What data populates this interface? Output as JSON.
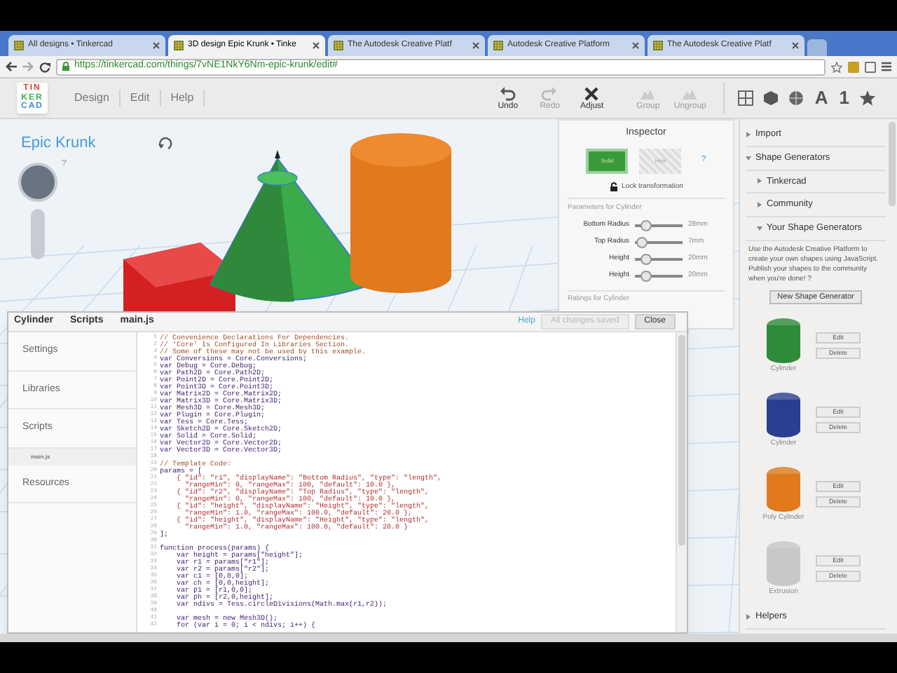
{
  "browser": {
    "tabs": [
      {
        "label": "All designs • Tinkercad",
        "selected": false
      },
      {
        "label": "3D design Epic Krunk • Tinke",
        "selected": true
      },
      {
        "label": "The Autodesk Creative Platf",
        "selected": false
      },
      {
        "label": "Autodesk Creative Platform",
        "selected": false
      },
      {
        "label": "The Autodesk Creative Platf",
        "selected": false
      }
    ],
    "url": "https://tinkercad.com/things/7vNE1NkY6Nm-epic-krunk/edit#"
  },
  "app_toolbar": {
    "logo": [
      "TIN",
      "KER",
      "CAD"
    ],
    "menu": [
      "Design",
      "Edit",
      "Help"
    ],
    "tools": [
      {
        "label": "Undo",
        "kind": "undo",
        "disabled": false
      },
      {
        "label": "Redo",
        "kind": "redo",
        "disabled": true
      },
      {
        "label": "Adjust",
        "kind": "adjust",
        "disabled": false
      },
      {
        "label": "Group",
        "kind": "group",
        "disabled": true
      },
      {
        "label": "Ungroup",
        "kind": "ungroup",
        "disabled": true
      }
    ],
    "view_glyphs": [
      "A",
      "1"
    ]
  },
  "design_title": "Epic Krunk",
  "view_help": "?",
  "inspector": {
    "title": "Inspector",
    "modes": [
      {
        "label": "Solid",
        "kind": "solid",
        "selected": true
      },
      {
        "label": "Hole",
        "kind": "hole",
        "selected": false
      }
    ],
    "help": "?",
    "lock_label": "Lock transformation",
    "params_heading": "Parameters for Cylinder",
    "params": [
      {
        "name": "Bottom Radius",
        "level": 0.15,
        "reading": "28mm"
      },
      {
        "name": "Top Radius",
        "level": 0.05,
        "reading": "7mm"
      },
      {
        "name": "Height",
        "level": 0.15,
        "reading": "20mm"
      },
      {
        "name": "Height",
        "level": 0.15,
        "reading": "20mm"
      }
    ],
    "ratings_heading": "Ratings for Cylinder"
  },
  "editor": {
    "breadcrumb": [
      "Cylinder",
      "Scripts",
      "main.js"
    ],
    "help_link": "Help",
    "save_status": "All changes saved",
    "close": "Close",
    "sidebar": [
      {
        "label": "Settings",
        "kind": "section",
        "selected": false
      },
      {
        "label": "Libraries",
        "kind": "section",
        "selected": false
      },
      {
        "label": "Scripts",
        "kind": "section",
        "selected": false
      },
      {
        "label": "main.js",
        "kind": "file",
        "selected": true
      },
      {
        "label": "Resources",
        "kind": "section",
        "selected": false
      }
    ],
    "code": [
      {
        "n": "1",
        "kind": "comment",
        "text": "// Convenience Declarations For Dependencies."
      },
      {
        "n": "2",
        "kind": "comment",
        "text": "// 'Core' Is Configured In Libraries Section."
      },
      {
        "n": "3",
        "kind": "comment",
        "text": "// Some of these may not be used by this example."
      },
      {
        "n": "4",
        "kind": "code",
        "text": "var Conversions = Core.Conversions;"
      },
      {
        "n": "5",
        "kind": "code",
        "text": "var Debug = Core.Debug;"
      },
      {
        "n": "6",
        "kind": "code",
        "text": "var Path2D = Core.Path2D;"
      },
      {
        "n": "7",
        "kind": "code",
        "text": "var Point2D = Core.Point2D;"
      },
      {
        "n": "8",
        "kind": "code",
        "text": "var Point3D = Core.Point3D;"
      },
      {
        "n": "9",
        "kind": "code",
        "text": "var Matrix2D = Core.Matrix2D;"
      },
      {
        "n": "10",
        "kind": "code",
        "text": "var Matrix3D = Core.Matrix3D;"
      },
      {
        "n": "11",
        "kind": "code",
        "text": "var Mesh3D = Core.Mesh3D;"
      },
      {
        "n": "12",
        "kind": "code",
        "text": "var Plugin = Core.Plugin;"
      },
      {
        "n": "13",
        "kind": "code",
        "text": "var Tess = Core.Tess;"
      },
      {
        "n": "14",
        "kind": "code",
        "text": "var Sketch2D = Core.Sketch2D;"
      },
      {
        "n": "15",
        "kind": "code",
        "text": "var Solid = Core.Solid;"
      },
      {
        "n": "16",
        "kind": "code",
        "text": "var Vector2D = Core.Vector2D;"
      },
      {
        "n": "17",
        "kind": "code",
        "text": "var Vector3D = Core.Vector3D;"
      },
      {
        "n": "18"
      },
      {
        "n": "19",
        "kind": "comment",
        "text": "// Template Code:"
      },
      {
        "n": "20",
        "kind": "code",
        "text": "params = ["
      },
      {
        "n": "21",
        "kind": "string",
        "text": "    { \"id\": \"r1\", \"displayName\": \"Bottom Radius\", \"type\": \"length\","
      },
      {
        "n": "22",
        "kind": "string",
        "text": "      \"rangeMin\": 0, \"rangeMax\": 100, \"default\": 10.0 },"
      },
      {
        "n": "23",
        "kind": "string",
        "text": "    { \"id\": \"r2\", \"displayName\": \"Top Radius\", \"type\": \"length\","
      },
      {
        "n": "24",
        "kind": "string",
        "text": "      \"rangeMin\": 0, \"rangeMax\": 100, \"default\": 10.0 },"
      },
      {
        "n": "25",
        "kind": "string",
        "text": "    { \"id\": \"height\", \"displayName\": \"Height\", \"type\": \"length\","
      },
      {
        "n": "26",
        "kind": "string",
        "text": "      \"rangeMin\": 1.0, \"rangeMax\": 100.0, \"default\": 20.0 },"
      },
      {
        "n": "27",
        "kind": "string",
        "text": "    { \"id\": \"height\", \"displayName\": \"Height\", \"type\": \"length\","
      },
      {
        "n": "28",
        "kind": "string",
        "text": "      \"rangeMin\": 1.0, \"rangeMax\": 100.0, \"default\": 20.0 }"
      },
      {
        "n": "29",
        "kind": "code",
        "text": "];"
      },
      {
        "n": "30"
      },
      {
        "n": "31",
        "kind": "code",
        "text": "function process(params) {"
      },
      {
        "n": "32",
        "kind": "code",
        "text": "    var height = params[\"height\"];"
      },
      {
        "n": "33",
        "kind": "code",
        "text": "    var r1 = params[\"r1\"];"
      },
      {
        "n": "34",
        "kind": "code",
        "text": "    var r2 = params[\"r2\"];"
      },
      {
        "n": "35",
        "kind": "code",
        "text": "    var c1 = [0,0,0];"
      },
      {
        "n": "36",
        "kind": "code",
        "text": "    var ch = [0,0,height];"
      },
      {
        "n": "37",
        "kind": "code",
        "text": "    var p1 = [r1,0,0];"
      },
      {
        "n": "38",
        "kind": "code",
        "text": "    var ph = [r2,0,height];"
      },
      {
        "n": "39",
        "kind": "code",
        "text": "    var ndivs = Tess.circleDivisions(Math.max(r1,r2));"
      },
      {
        "n": "40"
      },
      {
        "n": "41",
        "kind": "code",
        "text": "    var mesh = new Mesh3D();"
      },
      {
        "n": "42",
        "kind": "code",
        "text": "    for (var i = 0; i < ndivs; i++) {"
      }
    ]
  },
  "library": {
    "items": [
      {
        "label": "Import",
        "expanded": false
      },
      {
        "label": "Shape Generators",
        "expanded": true,
        "children": [
          {
            "label": "Tinkercad",
            "expanded": false
          },
          {
            "label": "Community",
            "expanded": false
          },
          {
            "label": "Your Shape Generators",
            "expanded": true,
            "description": "Use the Autodesk Creative Platform to create your own shapes using JavaScript. Publish your shapes to the community when you're done! ?",
            "new_button": "New Shape Generator",
            "generators": [
              {
                "name": "Cylinder",
                "color": "#2e8b3a",
                "edit": "Edit",
                "delete": "Delete"
              },
              {
                "name": "Cylinder",
                "color": "#2a3f8f",
                "edit": "Edit",
                "delete": "Delete"
              },
              {
                "name": "Poly Cylinder",
                "color": "#e07a1c",
                "edit": "Edit",
                "delete": "Delete"
              },
              {
                "name": "Extrusion",
                "color": "#c8c8c8",
                "edit": "Edit",
                "delete": "Delete"
              }
            ]
          }
        ]
      },
      {
        "label": "Helpers",
        "expanded": false
      }
    ]
  }
}
